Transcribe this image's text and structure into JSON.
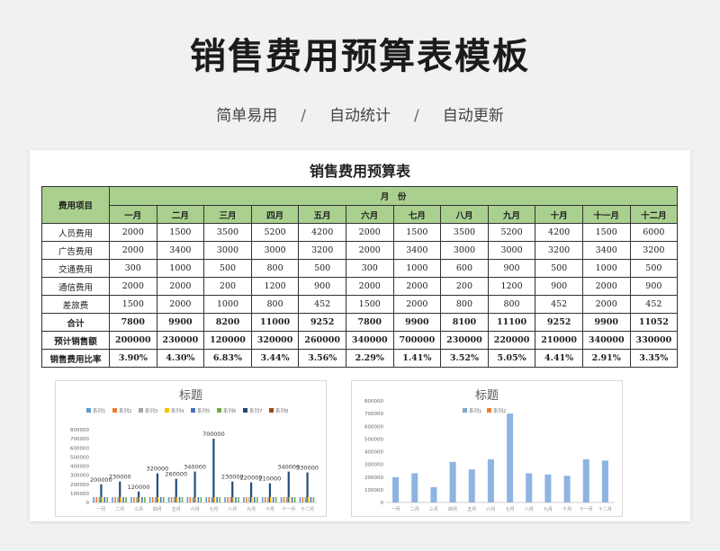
{
  "hero": {
    "title": "销售费用预算表模板",
    "tags": [
      "简单易用",
      "自动统计",
      "自动更新"
    ],
    "separator": "/"
  },
  "sheet": {
    "title": "销售费用预算表",
    "header_item": "费用项目",
    "header_month_group": "月　份",
    "months": [
      "一月",
      "二月",
      "三月",
      "四月",
      "五月",
      "六月",
      "七月",
      "八月",
      "九月",
      "十月",
      "十一月",
      "十二月"
    ],
    "rows": [
      {
        "label": "人员费用",
        "values": [
          "2000",
          "1500",
          "3500",
          "5200",
          "4200",
          "2000",
          "1500",
          "3500",
          "5200",
          "4200",
          "1500",
          "6000"
        ],
        "bold": false
      },
      {
        "label": "广告费用",
        "values": [
          "2000",
          "3400",
          "3000",
          "3000",
          "3200",
          "2000",
          "3400",
          "3000",
          "3000",
          "3200",
          "3400",
          "3200"
        ],
        "bold": false
      },
      {
        "label": "交通费用",
        "values": [
          "300",
          "1000",
          "500",
          "800",
          "500",
          "300",
          "1000",
          "600",
          "900",
          "500",
          "1000",
          "500"
        ],
        "bold": false
      },
      {
        "label": "通信费用",
        "values": [
          "2000",
          "2000",
          "200",
          "1200",
          "900",
          "2000",
          "2000",
          "200",
          "1200",
          "900",
          "2000",
          "900"
        ],
        "bold": false
      },
      {
        "label": "差旅费",
        "values": [
          "1500",
          "2000",
          "1000",
          "800",
          "452",
          "1500",
          "2000",
          "800",
          "800",
          "452",
          "2000",
          "452"
        ],
        "bold": false
      },
      {
        "label": "合计",
        "values": [
          "7800",
          "9900",
          "8200",
          "11000",
          "9252",
          "7800",
          "9900",
          "8100",
          "11100",
          "9252",
          "9900",
          "11052"
        ],
        "bold": true
      },
      {
        "label": "预计销售额",
        "values": [
          "200000",
          "230000",
          "120000",
          "320000",
          "260000",
          "340000",
          "700000",
          "230000",
          "220000",
          "210000",
          "340000",
          "330000"
        ],
        "bold": true
      },
      {
        "label": "销售费用比率",
        "values": [
          "3.90%",
          "4.30%",
          "6.83%",
          "3.44%",
          "3.56%",
          "2.29%",
          "1.41%",
          "3.52%",
          "5.05%",
          "4.41%",
          "2.91%",
          "3.35%"
        ],
        "bold": true
      }
    ]
  },
  "chart_data": [
    {
      "type": "bar",
      "title": "标题",
      "legend_position": "top",
      "legend": [
        "系列1",
        "系列2",
        "系列3",
        "系列4",
        "系列5",
        "系列6",
        "系列7",
        "系列8"
      ],
      "series_colors": [
        "#5b9bd5",
        "#ed7d31",
        "#a5a5a5",
        "#ffc000",
        "#4472c4",
        "#70ad47",
        "#264478",
        "#9e480e"
      ],
      "ylim": [
        0,
        800000
      ],
      "yticks": [
        0,
        100000,
        200000,
        300000,
        400000,
        500000,
        600000,
        700000,
        800000
      ],
      "categories": [
        "一月",
        "二月",
        "三月",
        "四月",
        "五月",
        "六月",
        "七月",
        "八月",
        "九月",
        "十月",
        "十一月",
        "十二月"
      ],
      "series": [
        {
          "name": "系列7",
          "values": [
            200000,
            230000,
            120000,
            320000,
            260000,
            340000,
            700000,
            230000,
            220000,
            210000,
            340000,
            330000
          ]
        }
      ]
    },
    {
      "type": "bar",
      "title": "标题",
      "legend_position": "top",
      "legend": [
        "系列1",
        "系列2"
      ],
      "series_colors": [
        "#7fa7d3",
        "#ed7d31"
      ],
      "ylim": [
        0,
        800000
      ],
      "yticks": [
        0,
        100000,
        200000,
        300000,
        400000,
        500000,
        600000,
        700000,
        800000
      ],
      "categories": [
        "一月",
        "二月",
        "三月",
        "四月",
        "五月",
        "六月",
        "七月",
        "八月",
        "九月",
        "十月",
        "十一月",
        "十二月"
      ],
      "series": [
        {
          "name": "系列1",
          "values": [
            200000,
            230000,
            120000,
            320000,
            260000,
            340000,
            700000,
            230000,
            220000,
            210000,
            340000,
            330000
          ]
        }
      ]
    }
  ]
}
